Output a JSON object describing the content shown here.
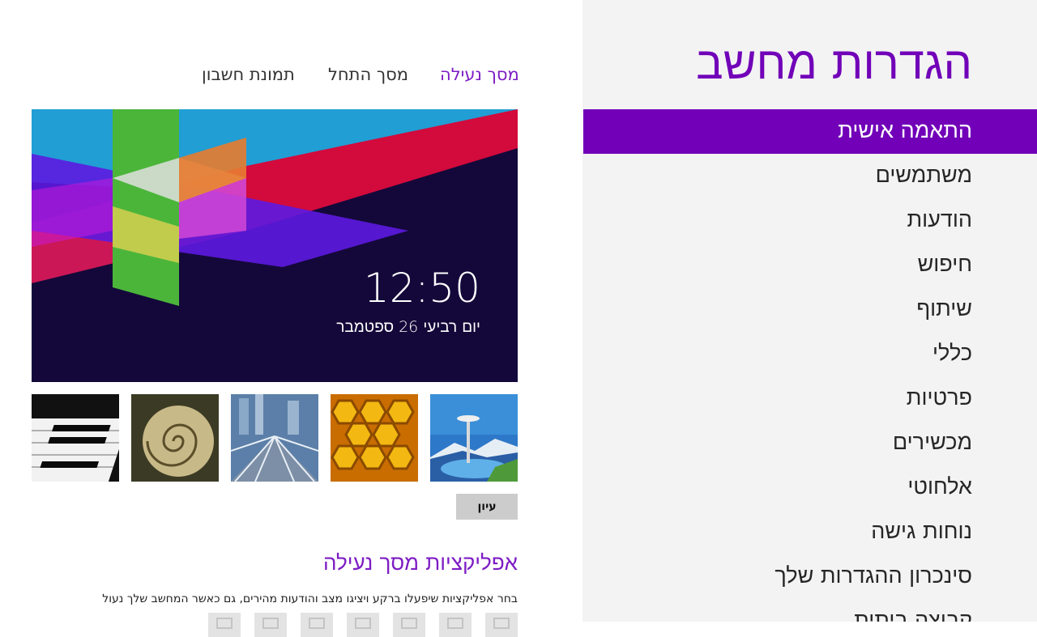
{
  "settings_pane": {
    "title": "הגדרות מחשב",
    "items": [
      {
        "label": "התאמה אישית",
        "active": true
      },
      {
        "label": "משתמשים"
      },
      {
        "label": "הודעות"
      },
      {
        "label": "חיפוש"
      },
      {
        "label": "שיתוף"
      },
      {
        "label": "כללי"
      },
      {
        "label": "פרטיות"
      },
      {
        "label": "מכשירים"
      },
      {
        "label": "אלחוטי"
      },
      {
        "label": "נוחות גישה"
      },
      {
        "label": "סינכרון ההגדרות שלך"
      },
      {
        "label": "קבוצה ביתית"
      }
    ]
  },
  "tabs": [
    {
      "label": "מסך נעילה",
      "active": true
    },
    {
      "label": "מסך התחל"
    },
    {
      "label": "תמונת חשבון"
    }
  ],
  "lock_preview": {
    "time": "12:50",
    "date": "יום רביעי 26 ספטמבר"
  },
  "thumbnails": [
    {
      "name": "space-needle-thumbnail"
    },
    {
      "name": "honeycomb-thumbnail"
    },
    {
      "name": "city-rail-thumbnail"
    },
    {
      "name": "nautilus-shell-thumbnail"
    },
    {
      "name": "piano-keys-thumbnail"
    }
  ],
  "browse_button": "עיון",
  "lock_apps": {
    "heading": "אפליקציות מסך נעילה",
    "description": "בחר אפליקציות שיפעלו ברקע ויציגו מצב והודעות מהירים, גם כאשר המחשב שלך נעול",
    "slots": 7
  },
  "colors": {
    "accent": "#7100b8",
    "pane_background": "#f3f3f3"
  }
}
